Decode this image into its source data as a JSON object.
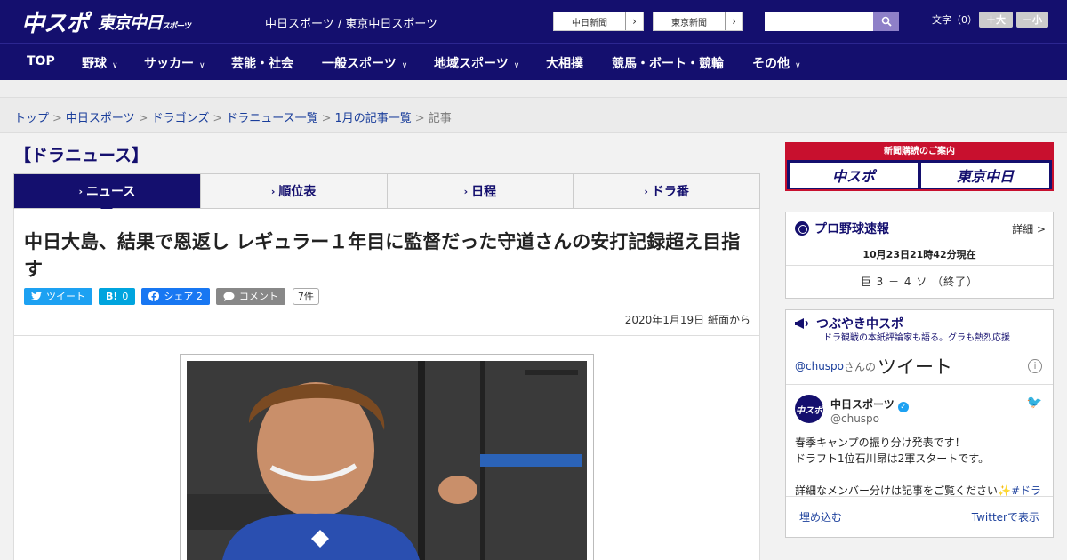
{
  "header": {
    "logo_primary": "中スポ",
    "logo_secondary": "東京中日",
    "logo_secondary_small": "スポーツ",
    "site_name": "中日スポーツ / 東京中日スポーツ",
    "ext_links": [
      {
        "label": "中日新聞",
        "arrow": "›"
      },
      {
        "label": "東京新聞",
        "arrow": "›"
      }
    ],
    "search": {
      "placeholder": "",
      "icon": "search-icon"
    },
    "fontsize": {
      "label": "文字（0）",
      "larger": "＋大",
      "smaller": "－小"
    }
  },
  "nav": {
    "items": [
      {
        "label": "TOP",
        "chev": ""
      },
      {
        "label": "野球",
        "chev": "∨"
      },
      {
        "label": "サッカー",
        "chev": "∨"
      },
      {
        "label": "芸能・社会",
        "chev": ""
      },
      {
        "label": "一般スポーツ",
        "chev": "∨"
      },
      {
        "label": "地域スポーツ",
        "chev": "∨"
      },
      {
        "label": "大相撲",
        "chev": ""
      },
      {
        "label": "競馬・ボート・競輪",
        "chev": ""
      },
      {
        "label": "その他",
        "chev": "∨"
      }
    ]
  },
  "breadcrumb": {
    "items": [
      "トップ",
      "中日スポーツ",
      "ドラゴンズ",
      "ドラニュース一覧",
      "1月の記事一覧"
    ],
    "separator": ">",
    "current": "記事"
  },
  "section_title": "【ドラニュース】",
  "tabs": [
    {
      "label": "ニュース",
      "chev": "›"
    },
    {
      "label": "順位表",
      "chev": "›"
    },
    {
      "label": "日程",
      "chev": "›"
    },
    {
      "label": "ドラ番",
      "chev": "›"
    }
  ],
  "article": {
    "headline": "中日大島、結果で恩返し レギュラー１年目に監督だった守道さんの安打記録超え目指す",
    "share": {
      "tweet": {
        "icon": "twitter-icon",
        "label": "ツイート"
      },
      "hatena": {
        "icon": "B!",
        "count": "0"
      },
      "facebook": {
        "icon": "facebook-icon",
        "label": "シェア",
        "count": "2"
      },
      "comment": {
        "icon": "comment-icon",
        "label": "コメント",
        "count": "7件"
      }
    },
    "dateline": "2020年1月19日 紙面から"
  },
  "sidebar": {
    "subscription": {
      "head": "新聞購読のご案内",
      "logo1": "中スポ",
      "logo2": "東京中日"
    },
    "scores": {
      "title": "プロ野球速報",
      "more": "詳細 >",
      "time": "10月23日21時42分現在",
      "line": "巨 3 － 4 ソ （終了）"
    },
    "tweets": {
      "title": "つぶやき中スポ",
      "subtitle": "ドラ観戦の本紙評論家も語る。グラも熱烈応援",
      "handle": "@chuspo",
      "handle_suffix": "さんの",
      "label": "ツイート",
      "info": "i",
      "tweet": {
        "name": "中日スポーツ",
        "verified": "✓",
        "username": "@chuspo",
        "bird": "🐦",
        "avatar": "中スポ",
        "lines": [
          "春季キャンプの振り分け発表です！",
          "ドラフト1位石川昂は2軍スタートです。",
          "",
          "詳細なメンバー分けは記事をご覧ください"
        ],
        "tail": "✨#ドラ"
      },
      "embed": "埋め込む",
      "view_on": "Twitterで表示"
    }
  },
  "colors": {
    "brand": "#140f6e",
    "accent": "#c8102e",
    "twitter": "#1da1f2",
    "link": "#1a3e9b"
  }
}
